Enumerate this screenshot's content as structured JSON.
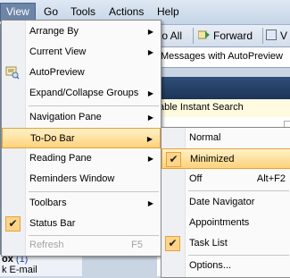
{
  "menubar": {
    "items": [
      {
        "label": "View"
      },
      {
        "label": "Go"
      },
      {
        "label": "Tools"
      },
      {
        "label": "Actions"
      },
      {
        "label": "Help"
      }
    ]
  },
  "toolbar": {
    "reply_all_label": "to All",
    "forward_label": "Forward",
    "extra_label": "V"
  },
  "message_strip": {
    "text": "Messages with AutoPreview"
  },
  "instant_search": {
    "text": "able Instant Search"
  },
  "left_pane": {
    "line1": "ox",
    "line1_count": "(1)",
    "line2": "k E-mail"
  },
  "view_menu": {
    "items": [
      {
        "label": "Arrange By",
        "has_submenu": true
      },
      {
        "label": "Current View",
        "has_submenu": true
      },
      {
        "label": "AutoPreview",
        "icon": "autopreview-icon"
      },
      {
        "label": "Expand/Collapse Groups",
        "has_submenu": true
      },
      {
        "label": "Navigation Pane",
        "has_submenu": true
      },
      {
        "label": "To-Do Bar",
        "has_submenu": true,
        "highlighted": true
      },
      {
        "label": "Reading Pane",
        "has_submenu": true
      },
      {
        "label": "Reminders Window"
      },
      {
        "label": "Toolbars",
        "has_submenu": true
      },
      {
        "label": "Status Bar",
        "checked": true
      },
      {
        "label": "Refresh",
        "shortcut": "F5",
        "disabled": true
      }
    ]
  },
  "todo_menu": {
    "items": [
      {
        "label": "Normal"
      },
      {
        "label": "Minimized",
        "checked": true,
        "highlighted": true
      },
      {
        "label": "Off",
        "shortcut": "Alt+F2"
      },
      {
        "label": "Date Navigator"
      },
      {
        "label": "Appointments"
      },
      {
        "label": "Task List",
        "checked": true
      },
      {
        "label": "Options..."
      }
    ]
  },
  "colors": {
    "highlight": "#ffd27b",
    "highlight_border": "#e3a33a",
    "active_menu": "#6d86a8"
  }
}
